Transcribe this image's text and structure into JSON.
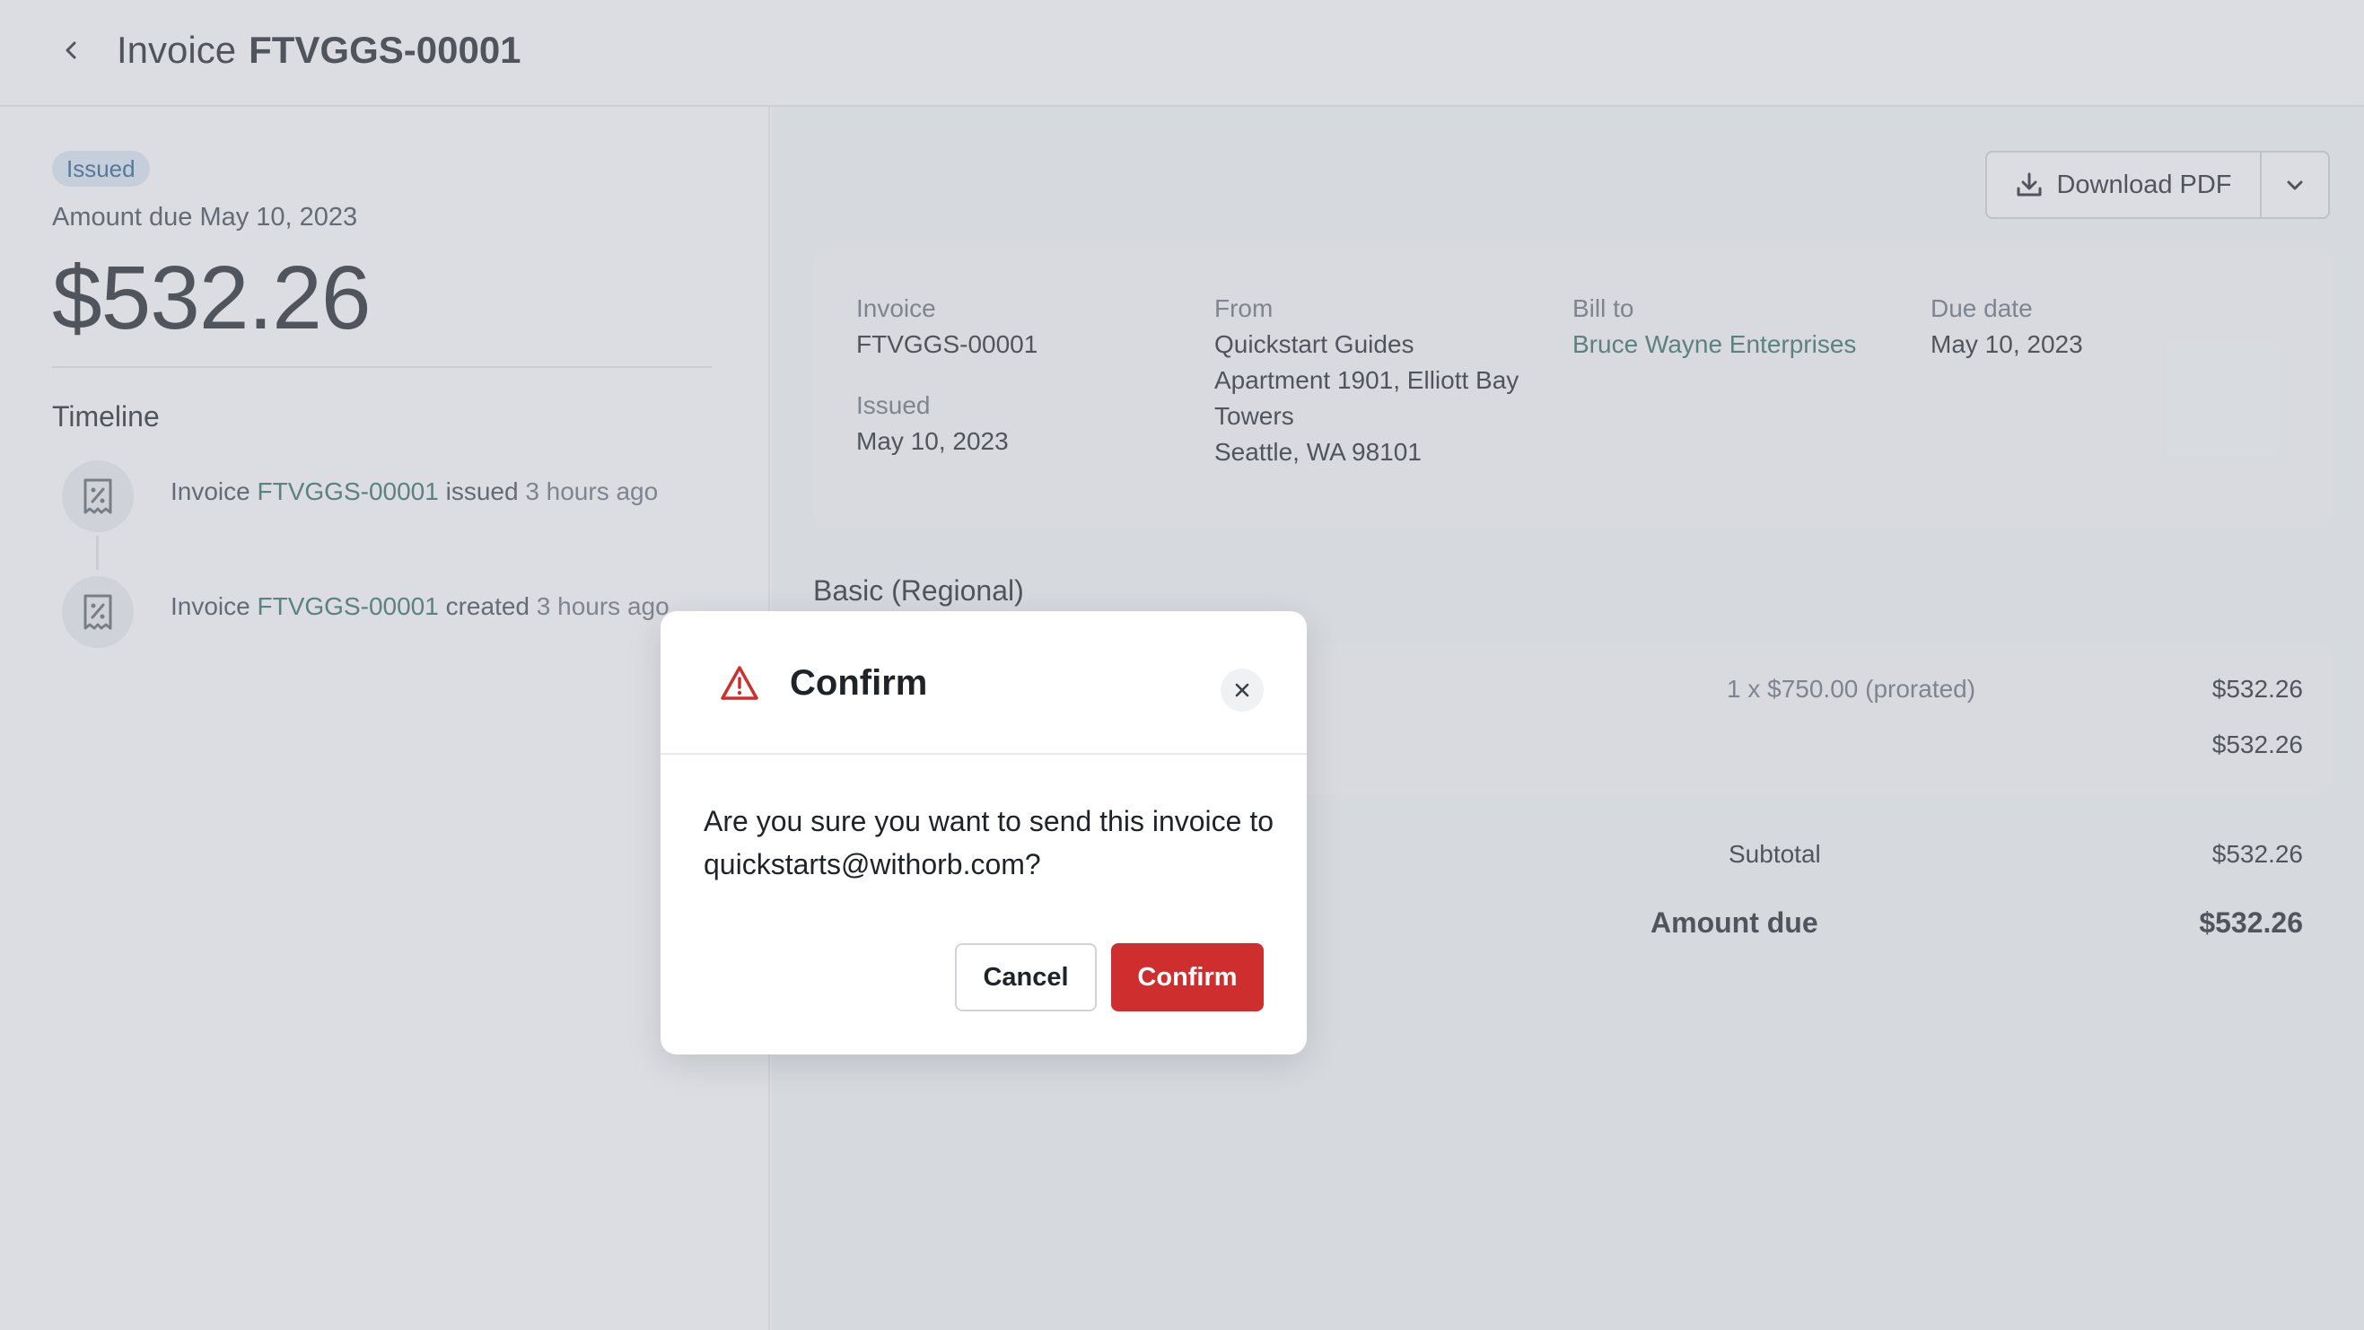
{
  "header": {
    "title_prefix": "Invoice",
    "invoice_number": "FTVGGS-00001"
  },
  "summary": {
    "status_badge": "Issued",
    "amount_due_label": "Amount due May 10, 2023",
    "amount_due_value": "$532.26"
  },
  "timeline": {
    "title": "Timeline",
    "events": [
      {
        "prefix": "Invoice",
        "link": "FTVGGS-00001",
        "action": "issued",
        "time": "3 hours ago"
      },
      {
        "prefix": "Invoice",
        "link": "FTVGGS-00001",
        "action": "created",
        "time": "3 hours ago"
      }
    ]
  },
  "toolbar": {
    "download_label": "Download PDF"
  },
  "invoice_info": {
    "invoice_label": "Invoice",
    "invoice_value": "FTVGGS-00001",
    "issued_label": "Issued",
    "issued_value": "May 10, 2023",
    "from_label": "From",
    "from_lines": [
      "Quickstart Guides",
      "Apartment 1901, Elliott Bay",
      "Towers",
      "Seattle, WA 98101"
    ],
    "bill_to_label": "Bill to",
    "bill_to_value": "Bruce Wayne Enterprises",
    "due_date_label": "Due date",
    "due_date_value": "May 10, 2023"
  },
  "line_items": {
    "section_title": "Basic (Regional)",
    "rows": [
      {
        "quantity_text": "1 x $750.00 (prorated)",
        "amount": "$532.26"
      },
      {
        "quantity_text": "",
        "amount": "$532.26"
      }
    ]
  },
  "totals": {
    "subtotal_label": "Subtotal",
    "subtotal_value": "$532.26",
    "amount_due_label": "Amount due",
    "amount_due_value": "$532.26"
  },
  "modal": {
    "title": "Confirm",
    "body": "Are you sure you want to send this invoice to quickstarts@withorb.com?",
    "cancel_label": "Cancel",
    "confirm_label": "Confirm"
  },
  "colors": {
    "danger": "#cf2e2e",
    "link": "#2f6d63",
    "badge_bg": "#dbe9f6"
  },
  "icons": [
    "chevron-left-icon",
    "receipt-icon",
    "download-icon",
    "chevron-down-icon",
    "warning-icon",
    "close-icon"
  ]
}
